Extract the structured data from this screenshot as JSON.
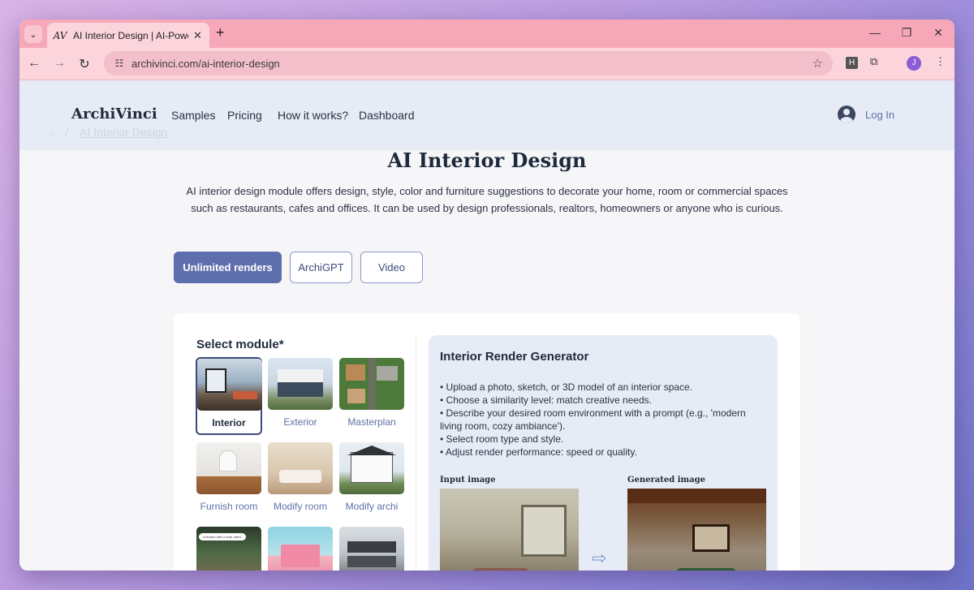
{
  "browser": {
    "tab_title": "AI Interior Design | AI-Powered",
    "tab_favicon": "AV",
    "url": "archivinci.com/ai-interior-design",
    "extension_letter": "H",
    "profile_initial": "J"
  },
  "site": {
    "brand": "ArchiVinci",
    "nav": [
      "Samples",
      "Pricing",
      "How it works?",
      "Dashboard"
    ],
    "login": "Log In",
    "breadcrumb": "AI Interior Design"
  },
  "main": {
    "title": "AI Interior Design",
    "intro": "AI interior design module offers design, style, color and furniture suggestions to decorate your home, room or commercial spaces such as restaurants, cafes and offices. It can be used by design professionals, realtors, homeowners or anyone who is curious.",
    "tabs": [
      "Unlimited renders",
      "ArchiGPT",
      "Video"
    ]
  },
  "modules": {
    "title": "Select module*",
    "items": [
      "Interior",
      "Exterior",
      "Masterplan",
      "Furnish room",
      "Modify room",
      "Modify archi"
    ],
    "thumb_caption": "a terrace with a sofa, interi..."
  },
  "generator": {
    "title": "Interior Render Generator",
    "bullets": [
      "Upload a photo, sketch, or 3D model of an interior space.",
      "Choose a similarity level: match creative needs.",
      "Describe your desired room environment with a prompt (e.g., 'modern living room, cozy ambiance').",
      "Select room type and style.",
      "Adjust render performance: speed or quality."
    ],
    "input_label": "Input image",
    "output_label": "Generated image"
  },
  "colors": {
    "accent": "#5f6fae",
    "header_bg": "#e6ebf5",
    "browser_chrome": "#f7a8b8"
  }
}
